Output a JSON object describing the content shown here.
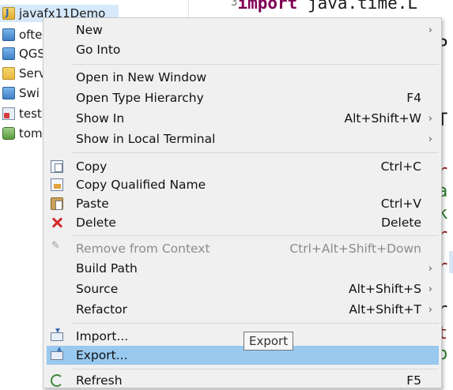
{
  "explorer": {
    "items": [
      {
        "label": "javafx11Demo",
        "icon": "java-project-icon",
        "selected": true
      },
      {
        "label": "ofte",
        "icon": "package-folder-icon"
      },
      {
        "label": "QGS",
        "icon": "package-folder-icon"
      },
      {
        "label": "Serv",
        "icon": "folder-icon"
      },
      {
        "label": "Swi",
        "icon": "package-folder-icon"
      },
      {
        "label": "test",
        "icon": "error-project-icon"
      },
      {
        "label": "tom",
        "icon": "server-icon"
      }
    ]
  },
  "editor": {
    "line_number": "3",
    "line_keyword": "import",
    "line_rest": " java.time.L",
    "fragments": [
      "P",
      "T",
      "r",
      "a",
      "k",
      "r",
      "r",
      "r",
      "t",
      "p"
    ]
  },
  "menu": {
    "items": [
      {
        "label": "New",
        "accel": "",
        "submenu": true
      },
      {
        "label": "Go Into",
        "accel": "",
        "submenu": false
      },
      {
        "label": "Open in New Window",
        "accel": "",
        "submenu": false
      },
      {
        "label": "Open Type Hierarchy",
        "accel": "F4",
        "submenu": false
      },
      {
        "label": "Show In",
        "accel": "Alt+Shift+W",
        "submenu": true
      },
      {
        "label": "Show in Local Terminal",
        "accel": "",
        "submenu": true
      },
      {
        "label": "Copy",
        "accel": "Ctrl+C",
        "submenu": false,
        "icon": "copy-icon"
      },
      {
        "label": "Copy Qualified Name",
        "accel": "",
        "submenu": false,
        "icon": "copy-qualified-name-icon"
      },
      {
        "label": "Paste",
        "accel": "Ctrl+V",
        "submenu": false,
        "icon": "paste-icon"
      },
      {
        "label": "Delete",
        "accel": "Delete",
        "submenu": false,
        "icon": "delete-icon"
      },
      {
        "label": "Remove from Context",
        "accel": "Ctrl+Alt+Shift+Down",
        "submenu": false,
        "disabled": true,
        "icon": "remove-from-context-icon"
      },
      {
        "label": "Build Path",
        "accel": "",
        "submenu": true
      },
      {
        "label": "Source",
        "accel": "Alt+Shift+S",
        "submenu": true
      },
      {
        "label": "Refactor",
        "accel": "Alt+Shift+T",
        "submenu": true
      },
      {
        "label": "Import...",
        "accel": "",
        "submenu": false,
        "icon": "import-icon"
      },
      {
        "label": "Export...",
        "accel": "",
        "submenu": false,
        "icon": "export-icon",
        "highlighted": true
      },
      {
        "label": "Refresh",
        "accel": "F5",
        "submenu": false,
        "icon": "refresh-icon"
      }
    ],
    "submenu_arrow": "›"
  },
  "tooltip": {
    "text": "Export"
  },
  "colors": {
    "menu_bg": "#f0f0f0",
    "highlight": "#99c9ef",
    "keyword": "#7f0055",
    "disabled_text": "#8c8c8c",
    "tree_selection": "#d6e9fb"
  }
}
